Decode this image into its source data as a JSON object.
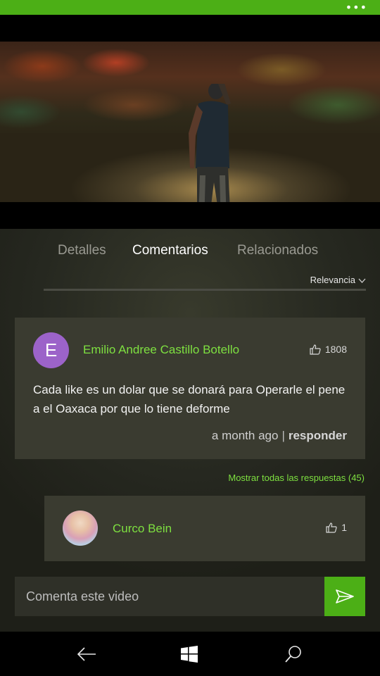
{
  "status_bar": {
    "menu_glyph": "•••",
    "color": "#4caf16"
  },
  "video": {
    "description_icon": "video-thumbnail"
  },
  "tabs": [
    {
      "label": "Detalles",
      "active": false
    },
    {
      "label": "Comentarios",
      "active": true
    },
    {
      "label": "Relacionados",
      "active": false
    }
  ],
  "sort": {
    "label": "Relevancia",
    "icon": "chevron-down-icon"
  },
  "comment": {
    "avatar_letter": "E",
    "avatar_color": "#9c63c9",
    "author": "Emilio Andree Castillo Botello",
    "likes": "1808",
    "text": "Cada like es un dolar que se donará para Operarle el pene a el Oaxaca por que lo tiene deforme",
    "time": "a month ago",
    "separator": "|",
    "reply_label": "responder"
  },
  "show_replies": "Mostrar todas las respuestas (45)",
  "reply": {
    "author": "Curco Bein",
    "likes": "1"
  },
  "composer": {
    "placeholder": "Comenta este video",
    "send_icon": "send-icon"
  },
  "accent_color": "#4caf16",
  "author_color": "#7ee040",
  "nav": {
    "back_icon": "back-arrow-icon",
    "home_icon": "windows-logo-icon",
    "search_icon": "search-icon"
  }
}
